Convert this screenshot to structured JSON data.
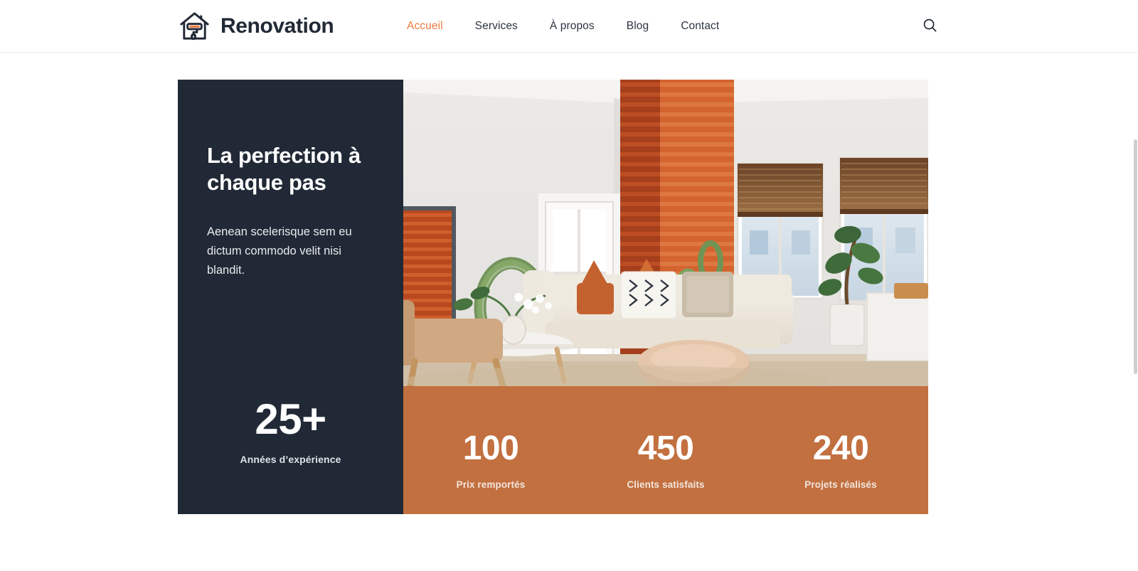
{
  "brand": {
    "name": "Renovation",
    "logo_icon": "house-paint-roller-icon",
    "logo_outline_color": "#212936",
    "logo_accent_color": "#f07b3f"
  },
  "header": {
    "nav": [
      {
        "label": "Accueil",
        "active": true,
        "icon": "nav-link-accueil"
      },
      {
        "label": "Services",
        "active": false,
        "icon": "nav-link-services"
      },
      {
        "label": "À propos",
        "active": false,
        "icon": "nav-link-a-propos"
      },
      {
        "label": "Blog",
        "active": false,
        "icon": "nav-link-blog"
      },
      {
        "label": "Contact",
        "active": false,
        "icon": "nav-link-contact"
      }
    ],
    "search_icon": "search-icon",
    "active_color": "#f07b3f",
    "text_color": "#2c3542"
  },
  "hero": {
    "title": "La perfection à chaque pas",
    "body": "Aenean scelerisque sem eu dictum commodo velit nisi blandit.",
    "panel_color": "#212936",
    "accent_color": "#c2703f",
    "image_alt": "living-room-interior-photo",
    "featured_stat": {
      "value": "25+",
      "label": "Années d’expérience"
    },
    "stats": [
      {
        "value": "100",
        "label": "Prix remportés"
      },
      {
        "value": "450",
        "label": "Clients satisfaits"
      },
      {
        "value": "240",
        "label": "Projets réalisés"
      }
    ]
  }
}
